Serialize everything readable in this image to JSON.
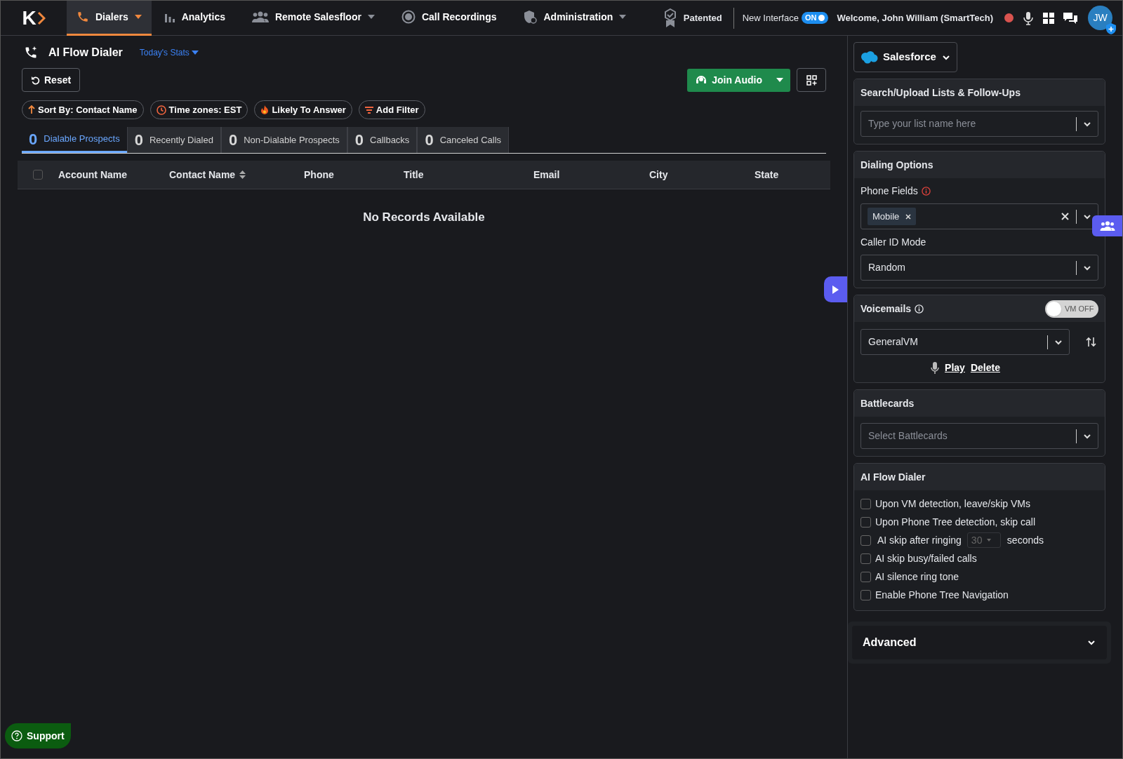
{
  "nav": {
    "logo": "K",
    "items": [
      {
        "label": "Dialers",
        "selected": true,
        "caret": true
      },
      {
        "label": "Analytics",
        "selected": false,
        "caret": false
      },
      {
        "label": "Remote Salesfloor",
        "selected": false,
        "caret": true
      },
      {
        "label": "Call Recordings",
        "selected": false,
        "caret": false
      },
      {
        "label": "Administration",
        "selected": false,
        "caret": true
      }
    ],
    "patented": "Patented",
    "new_interface": {
      "label": "New Interface",
      "toggle": "ON",
      "on": true
    },
    "welcome": "Welcome, John William (SmartTech)",
    "avatar": "JW"
  },
  "header": {
    "title": "AI Flow Dialer",
    "stats": "Today's Stats",
    "reset": "Reset",
    "join_audio": "Join Audio"
  },
  "filters": [
    "Sort By: Contact Name",
    "Time zones: EST",
    "Likely To Answer",
    "Add Filter"
  ],
  "tabs": [
    {
      "count": "0",
      "label": "Dialable Prospects",
      "selected": true
    },
    {
      "count": "0",
      "label": "Recently Dialed",
      "selected": false
    },
    {
      "count": "0",
      "label": "Non-Dialable Prospects",
      "selected": false
    },
    {
      "count": "0",
      "label": "Callbacks",
      "selected": false
    },
    {
      "count": "0",
      "label": "Canceled Calls",
      "selected": false
    }
  ],
  "table": {
    "select_all": false,
    "columns": [
      "Account Name",
      "Contact Name",
      "Phone",
      "Title",
      "Email",
      "City",
      "State"
    ],
    "empty": "No Records Available"
  },
  "support": "Support",
  "sidebar": {
    "crm": "Salesforce",
    "lists": {
      "title": "Search/Upload Lists & Follow-Ups",
      "placeholder": "Type your list name here"
    },
    "dialing": {
      "title": "Dialing Options",
      "phone_label": "Phone Fields",
      "phone_tag": "Mobile",
      "caller_label": "Caller ID Mode",
      "caller_value": "Random"
    },
    "voicemails": {
      "title": "Voicemails",
      "toggle": "VM OFF",
      "on": false,
      "value": "GeneralVM",
      "play": "Play",
      "delete": "Delete"
    },
    "battlecards": {
      "title": "Battlecards",
      "placeholder": "Select Battlecards"
    },
    "ai": {
      "title": "AI Flow Dialer",
      "options": [
        {
          "kind": "plain",
          "label": "Upon VM detection, leave/skip VMs",
          "checked": false
        },
        {
          "kind": "plain",
          "label": "Upon Phone Tree detection, skip call",
          "checked": false
        },
        {
          "kind": "timer",
          "label": "AI skip after ringing",
          "value": "30",
          "suffix": "seconds",
          "checked": false
        },
        {
          "kind": "plain",
          "label": "AI skip busy/failed calls",
          "checked": false
        },
        {
          "kind": "plain",
          "label": "AI silence ring tone",
          "checked": false
        },
        {
          "kind": "plain",
          "label": "Enable Phone Tree Navigation",
          "checked": false
        }
      ]
    },
    "advanced": {
      "label": "Advanced",
      "expanded": false
    }
  }
}
